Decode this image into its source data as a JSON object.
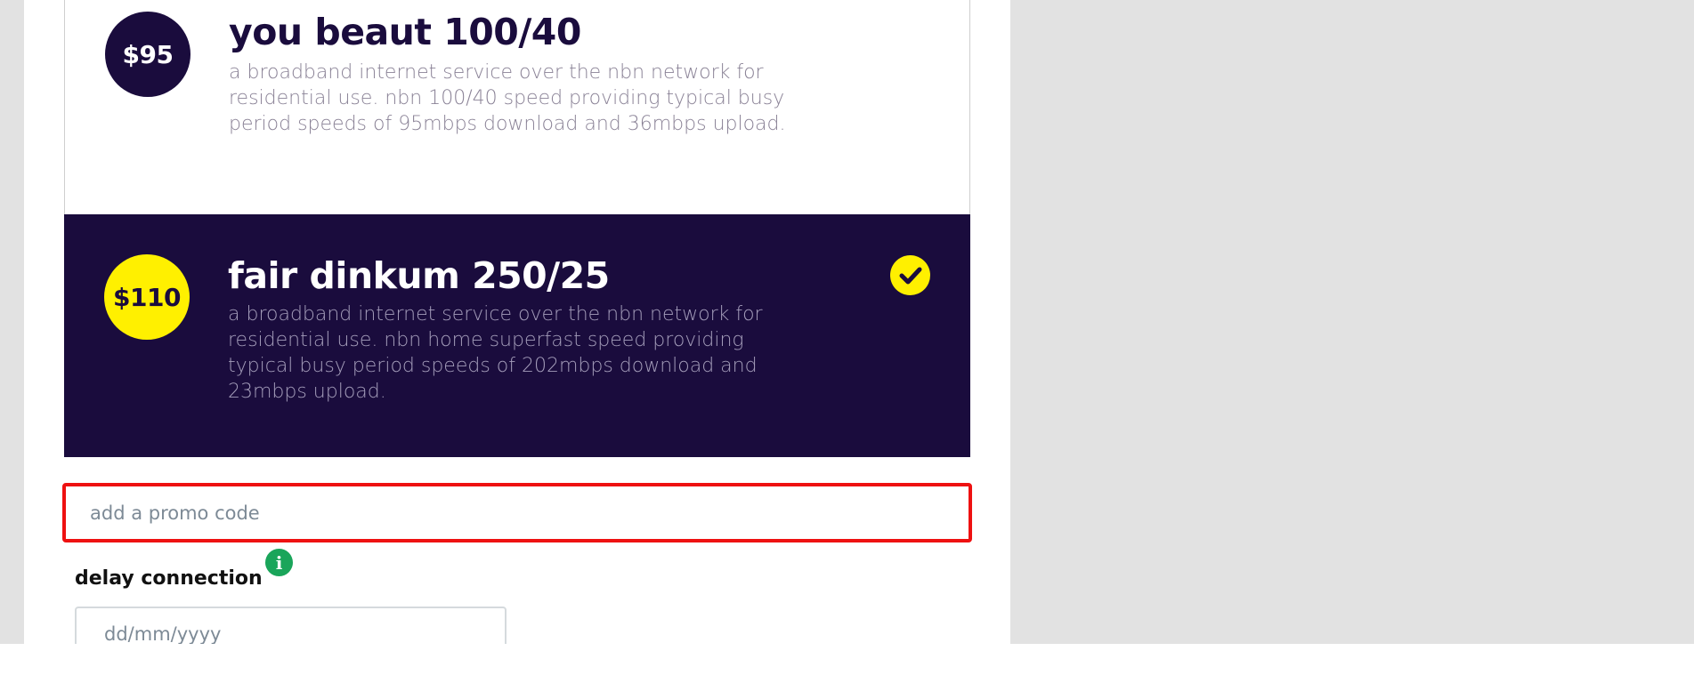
{
  "plans": [
    {
      "price": "$95",
      "title": "you beaut 100/40",
      "description": "a broadband internet service over the nbn network for residential use. nbn 100/40 speed providing typical busy period speeds of 95mbps download and 36mbps upload.",
      "selected": false
    },
    {
      "price": "$110",
      "title": "fair dinkum 250/25",
      "description": "a broadband internet service over the nbn network for residential use. nbn home superfast speed providing typical busy period speeds of 202mbps download and 23mbps upload.",
      "selected": true
    }
  ],
  "promo": {
    "placeholder": "add a promo code",
    "value": ""
  },
  "delay": {
    "label": "delay connection",
    "info_icon": "info-icon",
    "date_placeholder": "dd/mm/yyyy"
  },
  "colors": {
    "brand_navy": "#1a0c3d",
    "brand_yellow": "#fff000",
    "focus_red": "#ee1111",
    "info_green": "#1aa55a"
  },
  "icons": {
    "selected": "checkmark-icon"
  }
}
